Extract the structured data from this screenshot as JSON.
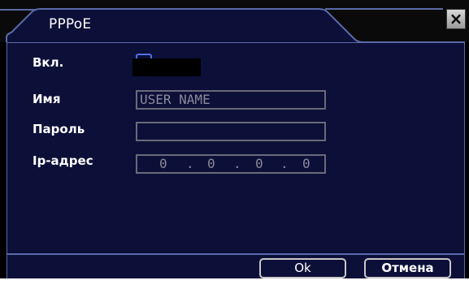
{
  "window": {
    "title": "PPPoE",
    "close_glyph": "×",
    "close_icon": "close-icon"
  },
  "form": {
    "enable_label": "Вкл.",
    "enable_checked": false,
    "name_label": "Имя",
    "name_placeholder": "USER NAME",
    "password_label": "Пароль",
    "password_value": "",
    "ip_label": "Ip-адрес",
    "ip_octets": [
      "0",
      "0",
      "0",
      "0"
    ]
  },
  "buttons": {
    "ok_label": "Ok",
    "cancel_label": "Отмена"
  },
  "colors": {
    "background": "#0c0f38",
    "border": "#5a6aa8",
    "text": "#ffffff",
    "field_text": "#8a8a98"
  }
}
